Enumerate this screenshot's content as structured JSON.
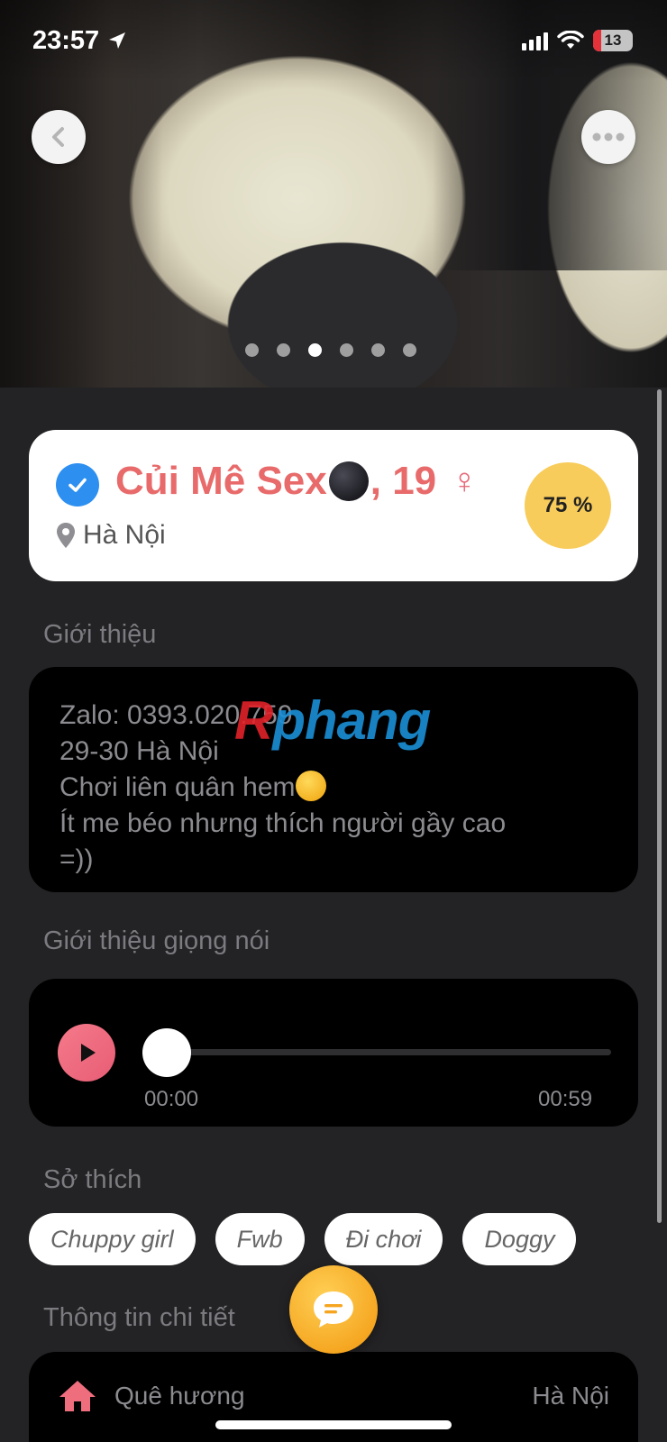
{
  "status_bar": {
    "time": "23:57",
    "battery_level": "13",
    "icons": [
      "location-arrow-icon",
      "signal-icon",
      "wifi-icon",
      "battery-icon"
    ]
  },
  "gallery": {
    "photo_count": 6,
    "active_index": 2
  },
  "profile": {
    "name": "Củi Mê Sex",
    "age_text": ", 19",
    "gender_symbol": "♀",
    "location": "Hà Nội",
    "match_percent": "75 %",
    "verified": true,
    "name_color": "#e86a6a",
    "verified_color": "#2d8ff0",
    "match_color": "#f8cc5a"
  },
  "intro": {
    "title": "Giới thiệu",
    "lines": [
      "Zalo: 0393.020.759",
      "29-30 Hà Nội",
      "Chơi liên quân hem",
      "Ít me béo nhưng thích người gầy cao",
      "=))"
    ]
  },
  "watermark": {
    "part_a": "R",
    "part_b": "phang"
  },
  "voice_intro": {
    "title": "Giới thiệu giọng nói",
    "current_time": "00:00",
    "duration": "00:59",
    "progress": 0
  },
  "hobbies": {
    "title": "Sở thích",
    "tags": [
      "Chuppy girl",
      "Fwb",
      "Đi chơi",
      "Doggy"
    ]
  },
  "details": {
    "title": "Thông tin chi tiết",
    "rows": [
      {
        "icon": "home-icon",
        "label": "Quê hương",
        "value": "Hà Nội"
      }
    ]
  },
  "colors": {
    "background": "#232325",
    "card": "#000000",
    "accent_pink": "#e85d75",
    "fab": "#f5a51f"
  }
}
